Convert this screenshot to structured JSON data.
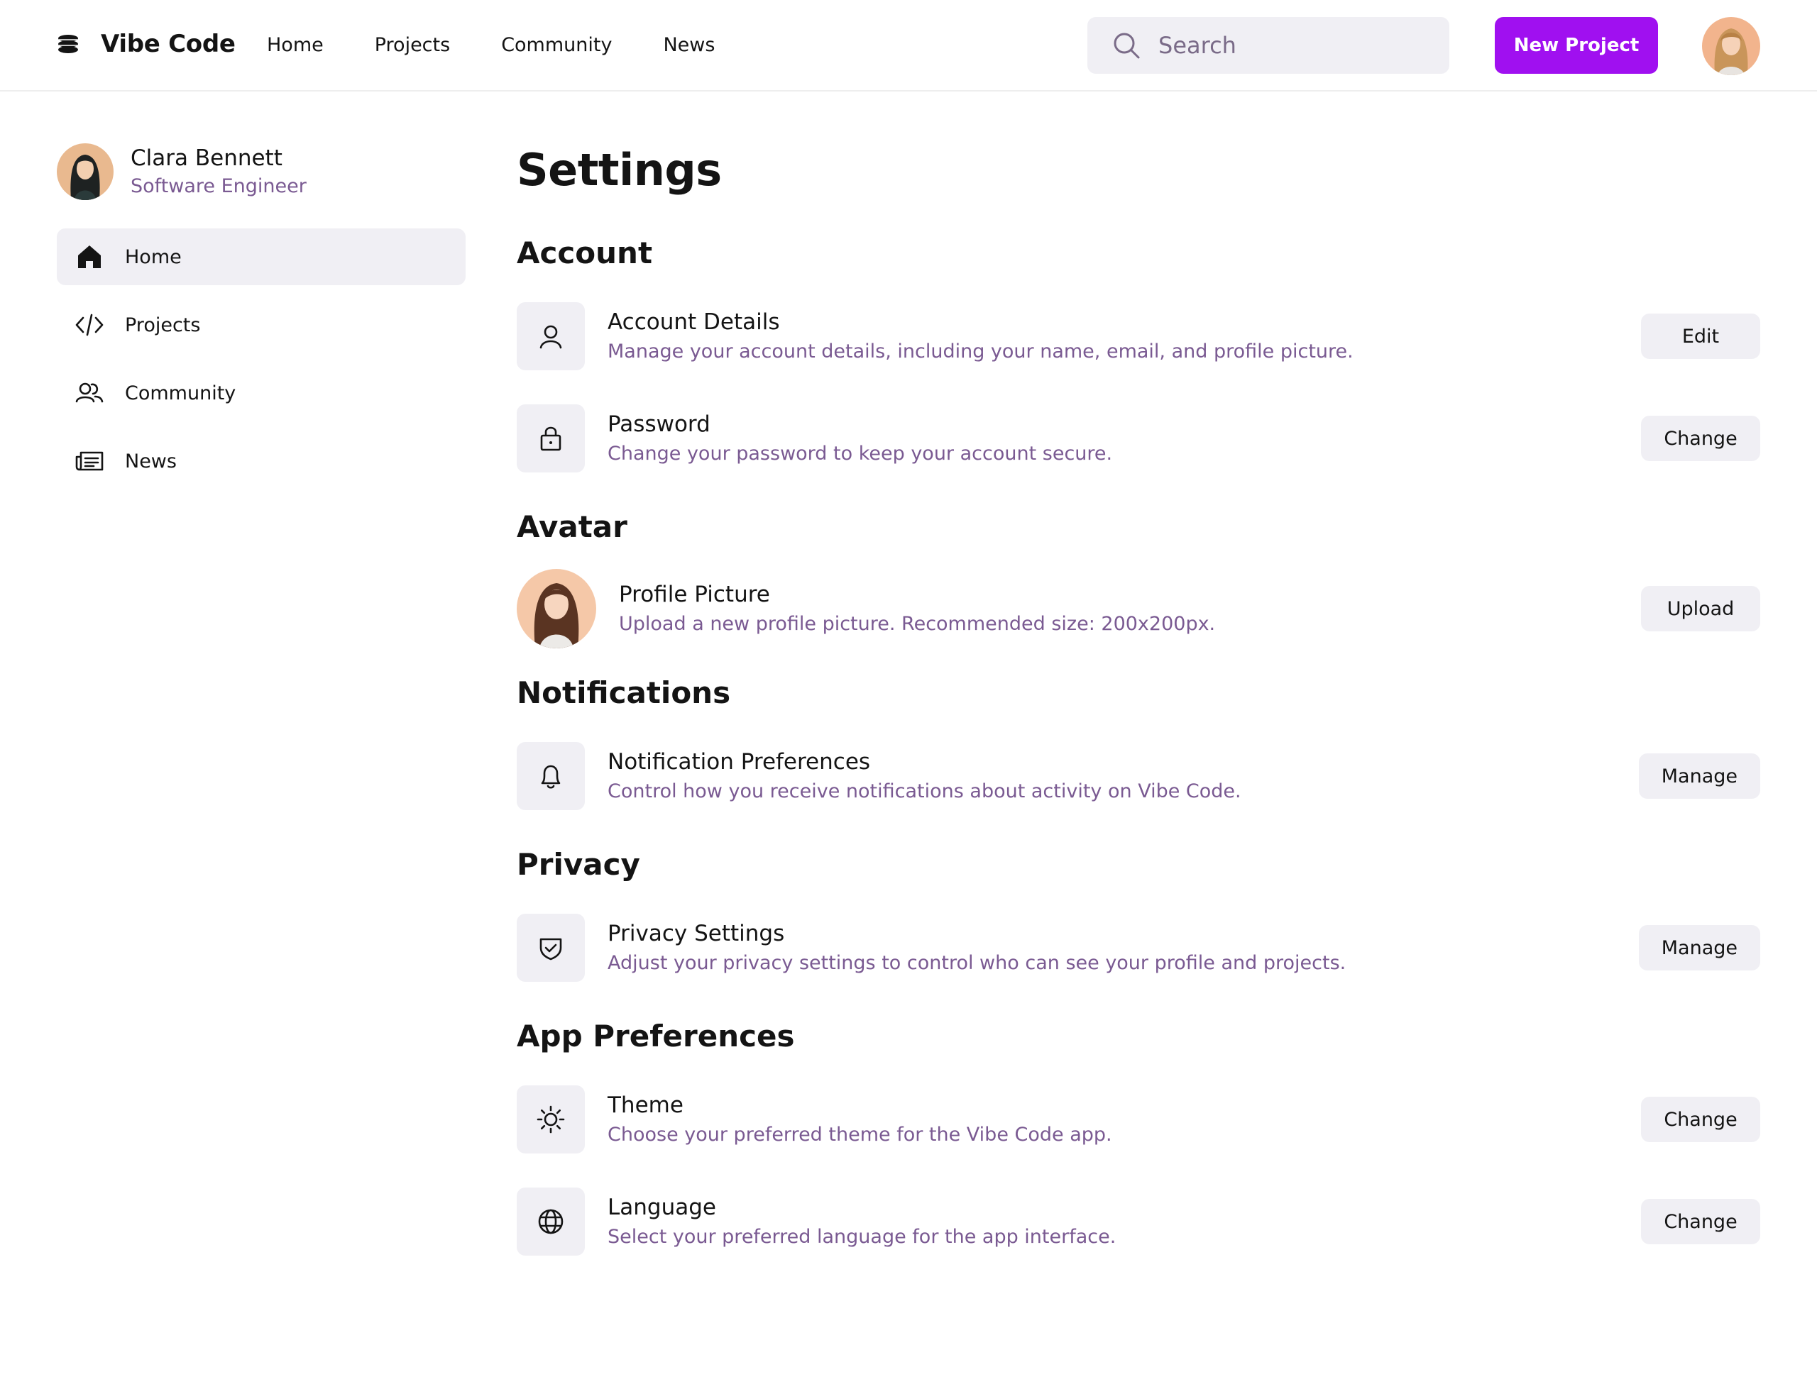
{
  "app": {
    "name": "Vibe Code",
    "logo_icon": "stack-logo-icon"
  },
  "topnav": {
    "items": [
      "Home",
      "Projects",
      "Community",
      "News"
    ]
  },
  "search": {
    "placeholder": "Search",
    "value": ""
  },
  "header": {
    "new_project_label": "New Project"
  },
  "colors": {
    "accent": "#a010f0",
    "muted_text": "#7a5a92",
    "surface": "#f0eff4"
  },
  "user": {
    "name": "Clara Bennett",
    "role": "Software Engineer"
  },
  "sidebar": {
    "items": [
      {
        "label": "Home",
        "icon": "home-icon",
        "active": true
      },
      {
        "label": "Projects",
        "icon": "code-icon",
        "active": false
      },
      {
        "label": "Community",
        "icon": "users-icon",
        "active": false
      },
      {
        "label": "News",
        "icon": "newspaper-icon",
        "active": false
      }
    ]
  },
  "main": {
    "title": "Settings",
    "sections": {
      "account": {
        "title": "Account",
        "rows": [
          {
            "name": "Account Details",
            "desc": "Manage your account details, including your name, email, and profile picture.",
            "action": "Edit",
            "icon": "user-icon"
          },
          {
            "name": "Password",
            "desc": "Change your password to keep your account secure.",
            "action": "Change",
            "icon": "lock-icon"
          }
        ]
      },
      "avatar": {
        "title": "Avatar",
        "row": {
          "name": "Profile Picture",
          "desc": "Upload a new profile picture. Recommended size: 200x200px.",
          "action": "Upload"
        }
      },
      "notifications": {
        "title": "Notifications",
        "row": {
          "name": "Notification Preferences",
          "desc": "Control how you receive notifications about activity on Vibe Code.",
          "action": "Manage",
          "icon": "bell-icon"
        }
      },
      "privacy": {
        "title": "Privacy",
        "row": {
          "name": "Privacy Settings",
          "desc": "Adjust your privacy settings to control who can see your profile and projects.",
          "action": "Manage",
          "icon": "shield-check-icon"
        }
      },
      "app_prefs": {
        "title": "App Preferences",
        "rows": [
          {
            "name": "Theme",
            "desc": "Choose your preferred theme for the Vibe Code app.",
            "action": "Change",
            "icon": "sun-icon"
          },
          {
            "name": "Language",
            "desc": "Select your preferred language for the app interface.",
            "action": "Change",
            "icon": "globe-icon"
          }
        ]
      }
    }
  }
}
